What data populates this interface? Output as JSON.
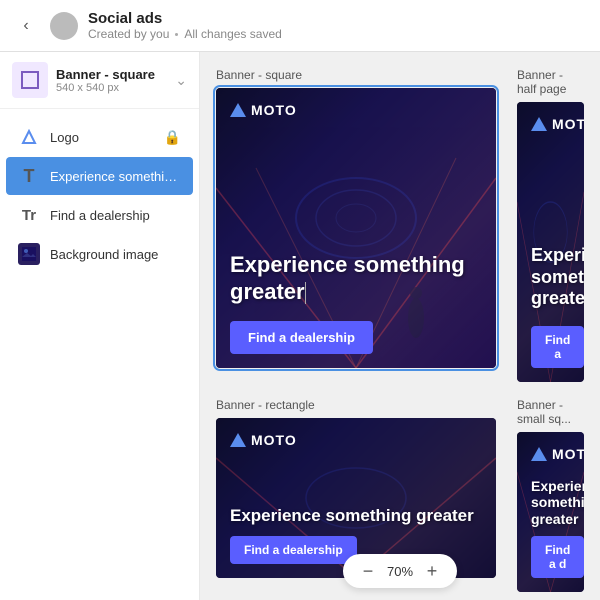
{
  "topbar": {
    "title": "Social ads",
    "subtitle_creator": "Created by you",
    "subtitle_status": "All changes saved"
  },
  "format_selector": {
    "name": "Banner - square",
    "size": "540 x 540 px"
  },
  "sidebar": {
    "items": [
      {
        "id": "logo",
        "label": "Logo",
        "type": "logo",
        "locked": true
      },
      {
        "id": "experience",
        "label": "Experience something...",
        "type": "text-large",
        "active": true
      },
      {
        "id": "find-dealership",
        "label": "Find a dealership",
        "type": "text-small"
      },
      {
        "id": "background-image",
        "label": "Background image",
        "type": "image"
      }
    ]
  },
  "banners": [
    {
      "id": "banner-square",
      "label": "Banner - square",
      "selected": true,
      "headline": "Experience something greater",
      "btn_label": "Find a dealership",
      "logo": "MOTO"
    },
    {
      "id": "banner-half-page",
      "label": "Banner - half page",
      "selected": false,
      "headline": "Experience something greater",
      "btn_label": "Find a",
      "logo": "MOTO"
    },
    {
      "id": "banner-rectangle",
      "label": "Banner - rectangle",
      "selected": false,
      "headline": "Experience something greater",
      "btn_label": "Find a dealership",
      "logo": "MOTO"
    },
    {
      "id": "banner-small-square",
      "label": "Banner - small sq...",
      "selected": false,
      "headline": "Experience something greater",
      "btn_label": "Find a d",
      "logo": "MOTO"
    }
  ],
  "zoom": {
    "level": "70%"
  }
}
